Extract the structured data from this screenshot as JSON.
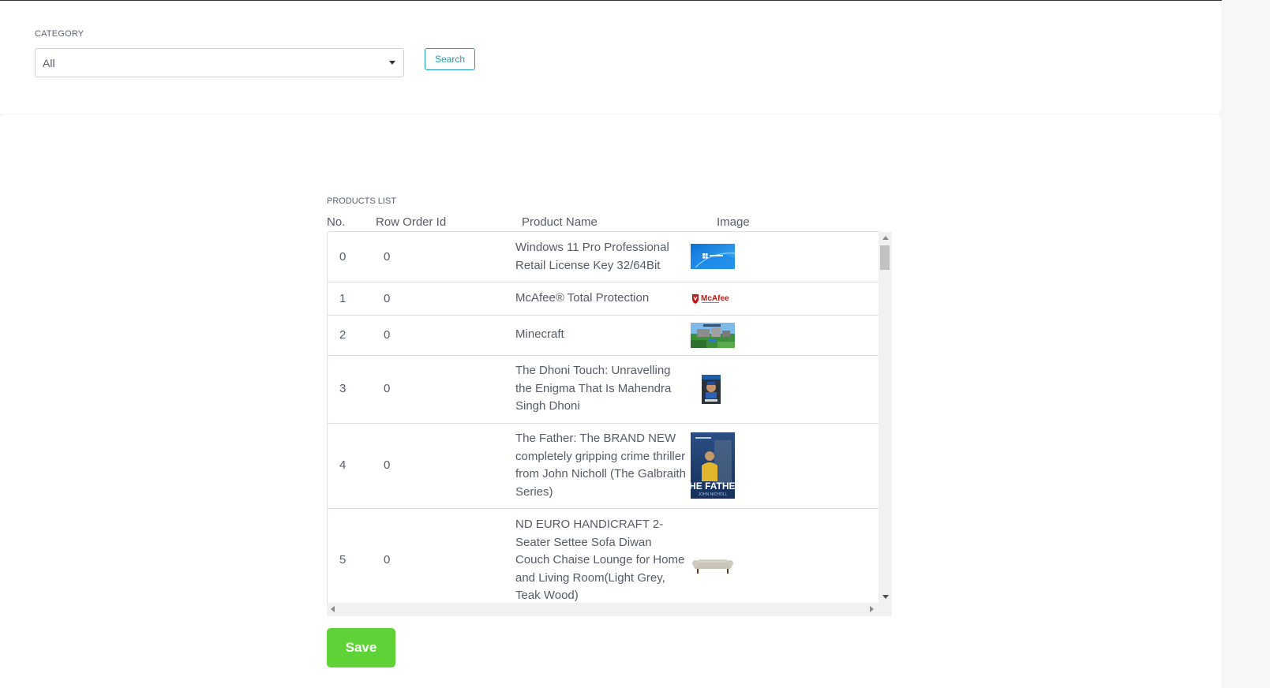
{
  "filter": {
    "category_label": "CATEGORY",
    "category_value": "All",
    "search_label": "Search"
  },
  "products": {
    "title": "PRODUCTS LIST",
    "columns": [
      "No.",
      "Row Order Id",
      "Product Name",
      "Image"
    ],
    "rows": [
      {
        "no": "0",
        "order_id": "0",
        "name": "Windows 11 Pro Professional Retail License Key 32/64Bit",
        "image": "windows-11-thumbnail"
      },
      {
        "no": "1",
        "order_id": "0",
        "name": "McAfee® Total Protection",
        "image": "mcafee-logo-thumbnail",
        "image_text": "McAfee"
      },
      {
        "no": "2",
        "order_id": "0",
        "name": "Minecraft",
        "image": "minecraft-thumbnail"
      },
      {
        "no": "3",
        "order_id": "0",
        "name": "The Dhoni Touch: Unravelling the Enigma That Is Mahendra Singh Dhoni",
        "image": "dhoni-book-cover-thumbnail"
      },
      {
        "no": "4",
        "order_id": "0",
        "name": "The Father: The BRAND NEW completely gripping crime thriller from John Nicholl (The Galbraith Series)",
        "image": "the-father-book-cover-thumbnail",
        "image_text": "THE FATHER",
        "image_subtext": "JOHN NICHOLL"
      },
      {
        "no": "5",
        "order_id": "0",
        "name": "ND EURO HANDICRAFT 2-Seater Settee Sofa Diwan Couch Chaise Lounge for Home and Living Room(Light Grey, Teak Wood)",
        "image": "sofa-thumbnail"
      }
    ]
  },
  "actions": {
    "save_label": "Save"
  },
  "colors": {
    "accent_teal": "#1a9fb5",
    "save_green": "#5ed236",
    "text": "#555b66"
  }
}
